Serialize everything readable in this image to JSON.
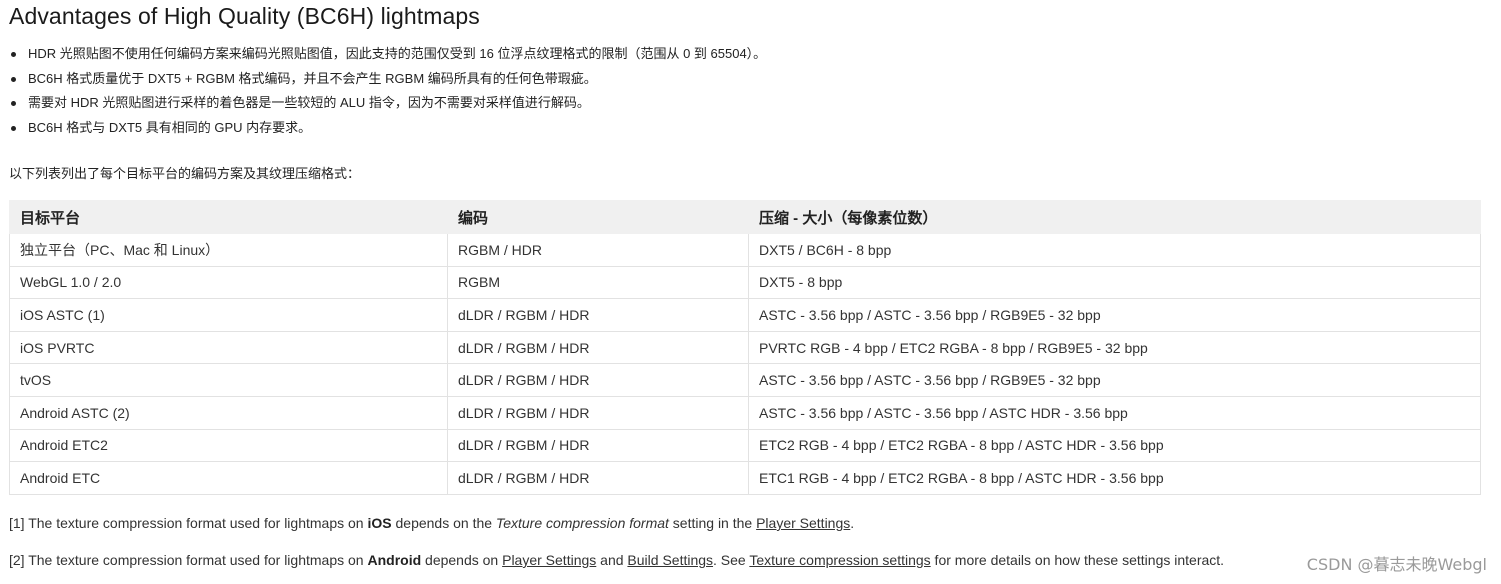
{
  "heading": "Advantages of High Quality (BC6H) lightmaps",
  "bullets": [
    "HDR 光照贴图不使用任何编码方案来编码光照贴图值，因此支持的范围仅受到 16 位浮点纹理格式的限制（范围从 0 到 65504）。",
    "BC6H 格式质量优于 DXT5 + RGBM 格式编码，并且不会产生 RGBM 编码所具有的任何色带瑕疵。",
    "需要对 HDR 光照贴图进行采样的着色器是一些较短的 ALU 指令，因为不需要对采样值进行解码。",
    "BC6H 格式与 DXT5 具有相同的 GPU 内存要求。"
  ],
  "intro": "以下列表列出了每个目标平台的编码方案及其纹理压缩格式：",
  "table": {
    "headers": [
      "目标平台",
      "编码",
      "压缩 - 大小（每像素位数）"
    ],
    "rows": [
      [
        "独立平台（PC、Mac 和 Linux）",
        "RGBM / HDR",
        "DXT5 / BC6H - 8 bpp"
      ],
      [
        "WebGL 1.0 / 2.0",
        "RGBM",
        "DXT5 - 8 bpp"
      ],
      [
        "iOS ASTC (1)",
        "dLDR / RGBM / HDR",
        "ASTC - 3.56 bpp / ASTC - 3.56 bpp / RGB9E5 - 32 bpp"
      ],
      [
        "iOS PVRTC",
        "dLDR / RGBM / HDR",
        "PVRTC RGB - 4 bpp / ETC2 RGBA - 8 bpp / RGB9E5 - 32 bpp"
      ],
      [
        "tvOS",
        "dLDR / RGBM / HDR",
        "ASTC - 3.56 bpp / ASTC - 3.56 bpp / RGB9E5 - 32 bpp"
      ],
      [
        "Android ASTC (2)",
        "dLDR / RGBM / HDR",
        "ASTC - 3.56 bpp / ASTC - 3.56 bpp / ASTC HDR - 3.56 bpp"
      ],
      [
        "Android ETC2",
        "dLDR / RGBM / HDR",
        "ETC2 RGB - 4 bpp / ETC2 RGBA - 8 bpp / ASTC HDR - 3.56 bpp"
      ],
      [
        "Android ETC",
        "dLDR / RGBM / HDR",
        "ETC1 RGB - 4 bpp / ETC2 RGBA - 8 bpp / ASTC HDR - 3.56 bpp"
      ]
    ]
  },
  "note1": {
    "prefix": "[1] The texture compression format used for lightmaps on ",
    "bold": "iOS",
    "mid": " depends on the ",
    "italic": "Texture compression format",
    "mid2": " setting in the ",
    "link": "Player Settings",
    "suffix": "."
  },
  "note2": {
    "prefix": "[2] The texture compression format used for lightmaps on ",
    "bold": "Android",
    "mid": " depends on ",
    "link1": "Player Settings",
    "and": " and ",
    "link2": "Build Settings",
    "mid2": ". See ",
    "link3": "Texture compression settings",
    "suffix": " for more details on how these settings interact."
  },
  "watermark": "CSDN @暮志未晚Webgl"
}
